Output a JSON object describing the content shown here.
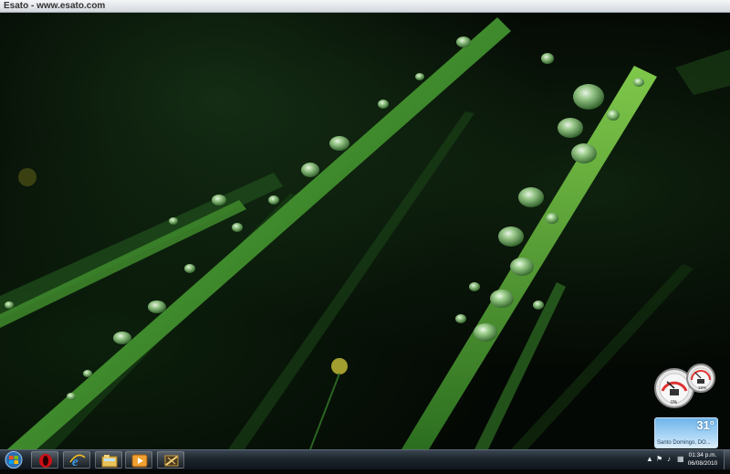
{
  "window": {
    "title": "Esato - www.esato.com"
  },
  "desktop": {
    "wallpaper": "green-grass-water-drops"
  },
  "gadgets": {
    "meter": {
      "label_left": "0%",
      "label_right": "19%"
    },
    "weather": {
      "temperature": "31°",
      "location": "Santo Domingo, DO..."
    }
  },
  "taskbar": {
    "start_icon": "windows-logo-icon",
    "pinned": [
      {
        "name": "opera",
        "icon": "opera-icon"
      },
      {
        "name": "internet-explorer",
        "icon": "ie-icon"
      },
      {
        "name": "windows-explorer",
        "icon": "folder-icon"
      },
      {
        "name": "media-player",
        "icon": "media-player-icon"
      },
      {
        "name": "media-center",
        "icon": "media-center-icon"
      }
    ],
    "tray": {
      "time": "01:34 p.m.",
      "date": "06/08/2010"
    }
  },
  "colors": {
    "taskbar": "#1d252d",
    "weather_sky": "#6fb4ea",
    "grass": "#3f8a2c"
  }
}
